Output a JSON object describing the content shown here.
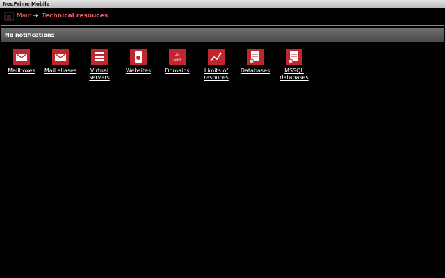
{
  "app": {
    "title": "NeuPrime Mobile"
  },
  "breadcrumb": {
    "main": "Main",
    "separator": "→",
    "current": "Technical resouces"
  },
  "notification": {
    "text": "No notifications"
  },
  "colors": {
    "accent": "#c0272d",
    "link": "#e36a6a"
  },
  "tiles": [
    {
      "label": "Mailboxes",
      "icon": "mailbox-icon"
    },
    {
      "label": "Mail aliases",
      "icon": "mail-alias-icon"
    },
    {
      "label": "Virtual servers",
      "icon": "server-icon"
    },
    {
      "label": "Websites",
      "icon": "website-icon"
    },
    {
      "label": "Domains",
      "icon": "domain-icon",
      "icon_text": ".ru .com"
    },
    {
      "label": "Limits of resouces",
      "icon": "chart-icon"
    },
    {
      "label": "Databases",
      "icon": "database-icon"
    },
    {
      "label": "MSSQL databases",
      "icon": "mssql-database-icon"
    }
  ]
}
